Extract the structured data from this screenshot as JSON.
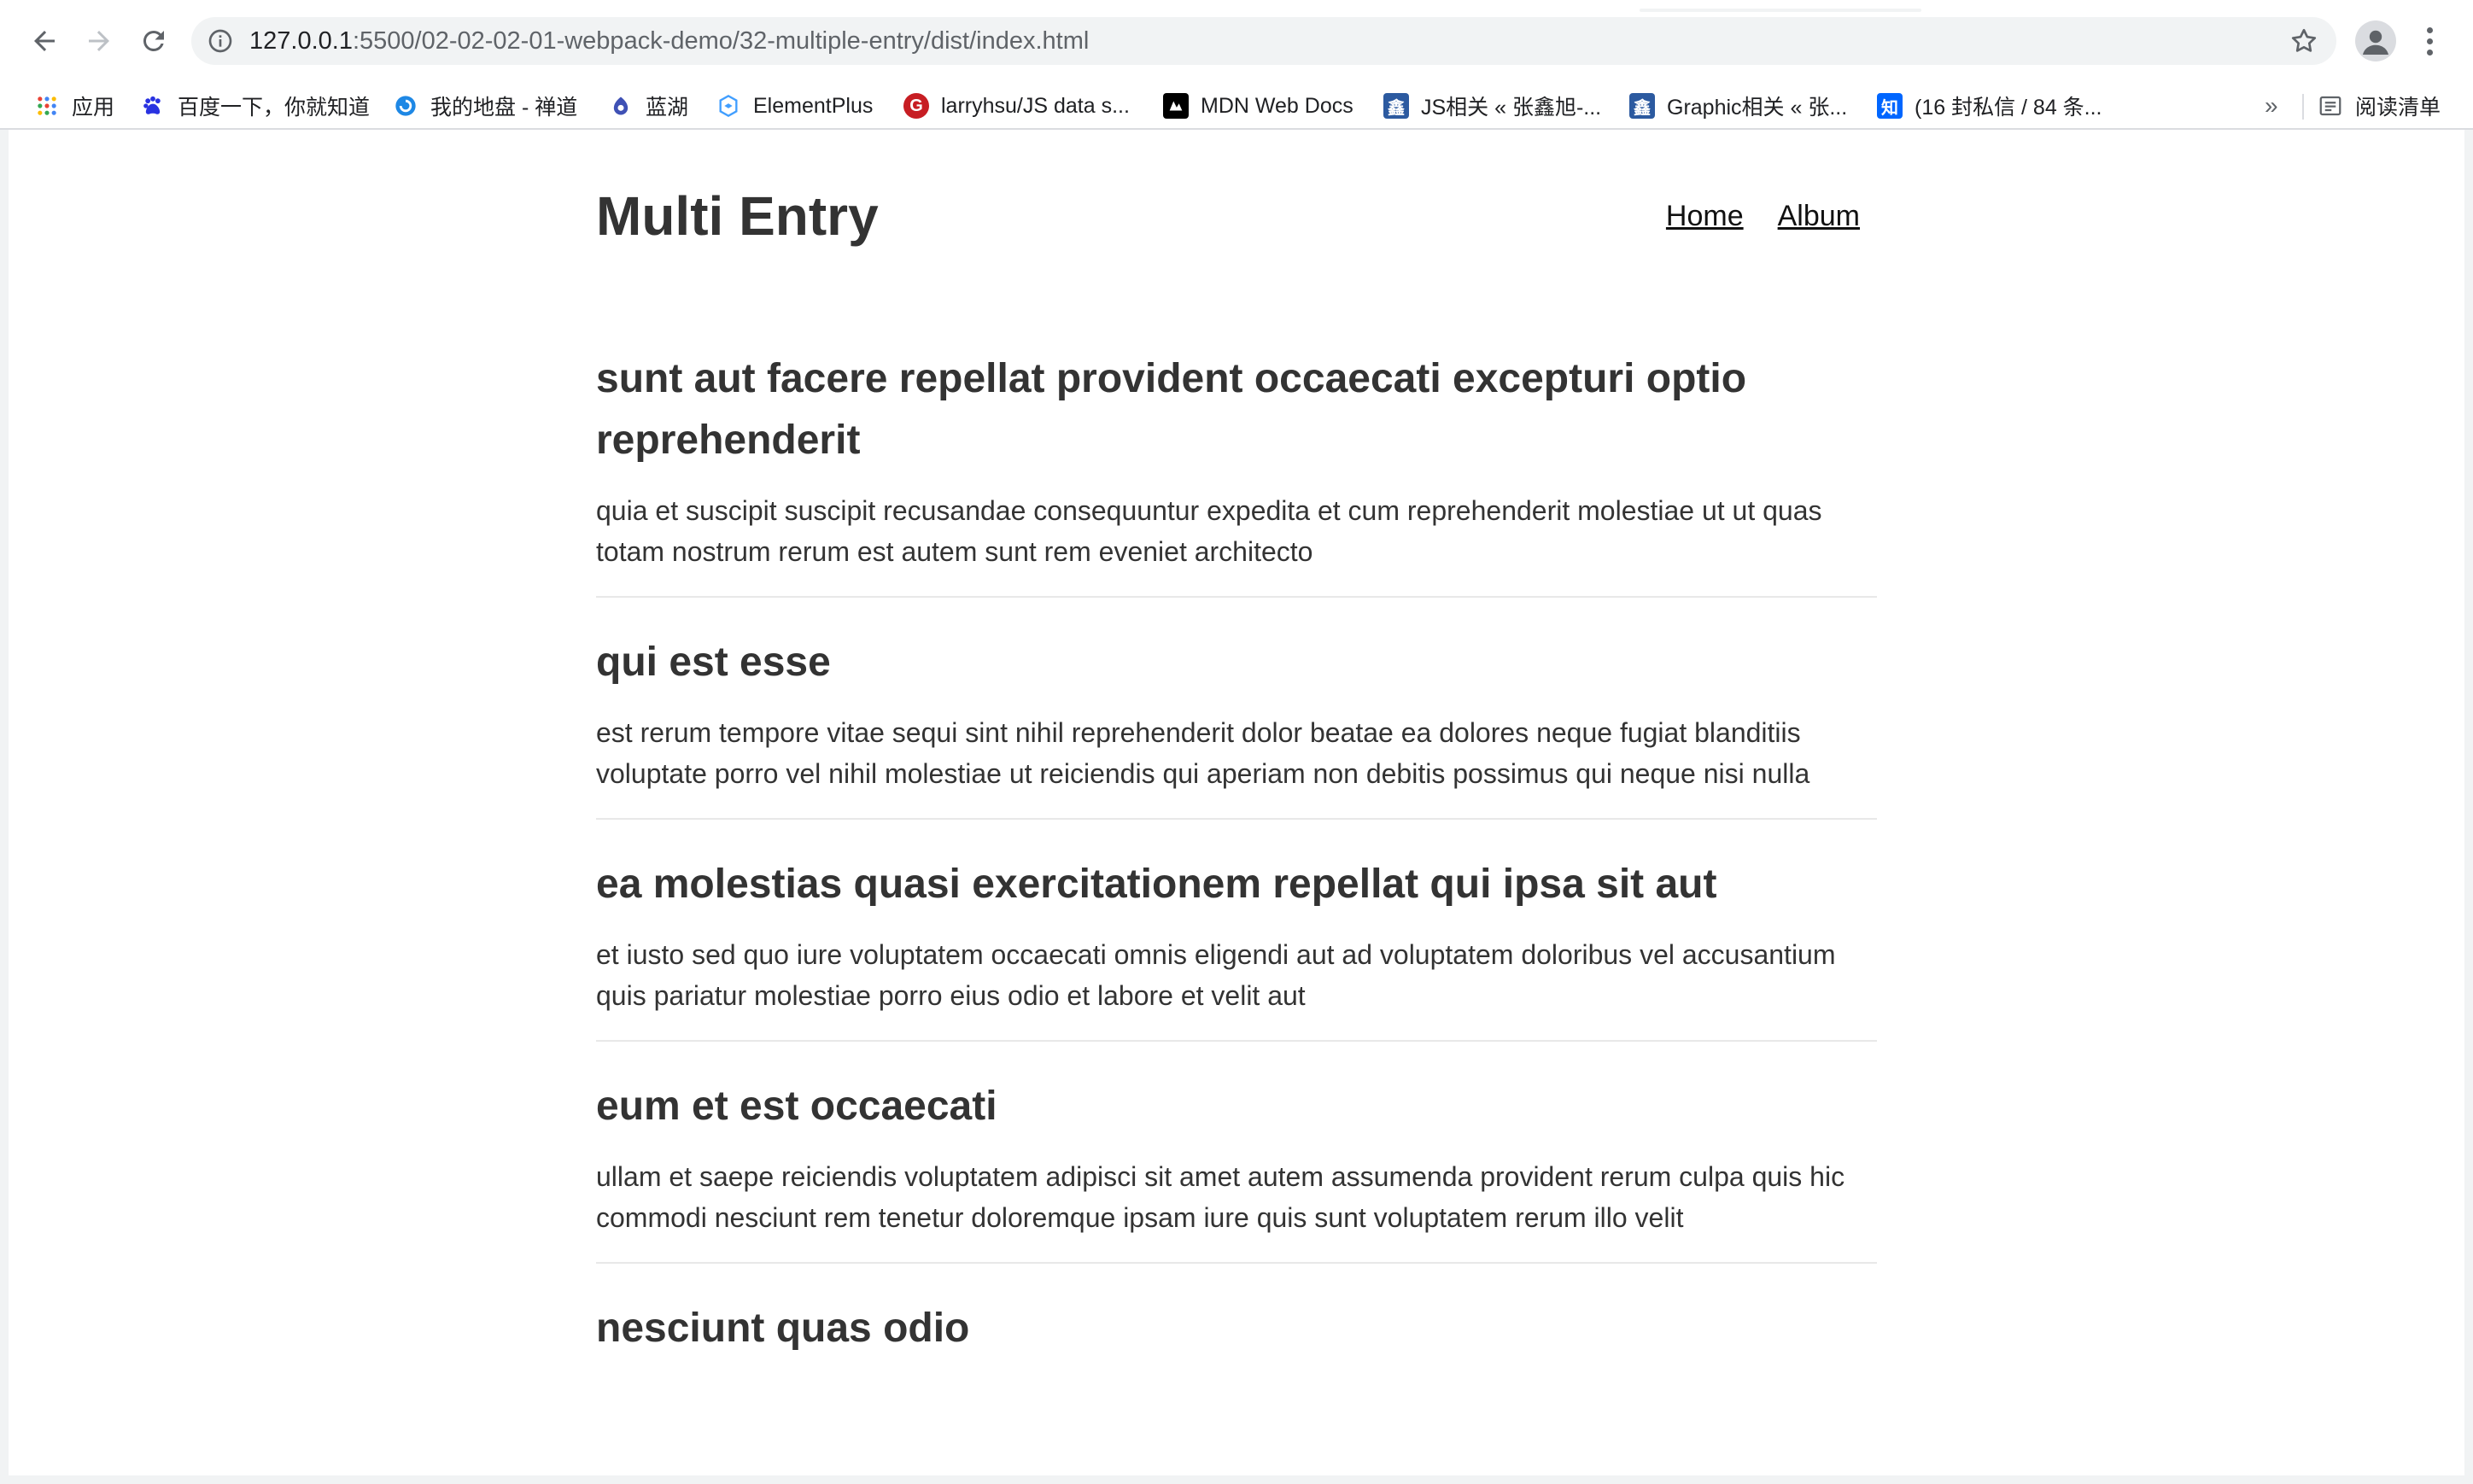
{
  "browser": {
    "url_host": "127.0.0.1",
    "url_path": ":5500/02-02-02-01-webpack-demo/32-multiple-entry/dist/index.html",
    "bookmarks": [
      {
        "label": "应用",
        "icon": "apps-grid-icon"
      },
      {
        "label": "百度一下，你就知道",
        "icon": "baidu-icon"
      },
      {
        "label": "我的地盘 - 禅道",
        "icon": "zentao-icon"
      },
      {
        "label": "蓝湖",
        "icon": "lanhu-icon"
      },
      {
        "label": "ElementPlus",
        "icon": "elementplus-icon"
      },
      {
        "label": "larryhsu/JS data s...",
        "icon": "gitee-icon"
      },
      {
        "label": "MDN Web Docs",
        "icon": "mdn-icon"
      },
      {
        "label": "JS相关 « 张鑫旭-...",
        "icon": "zxx-icon"
      },
      {
        "label": "Graphic相关 « 张...",
        "icon": "zxx-icon"
      },
      {
        "label": "(16 封私信 / 84 条...",
        "icon": "zhihu-icon"
      }
    ],
    "more_label": "»",
    "reading_list_label": "阅读清单"
  },
  "site": {
    "title": "Multi Entry",
    "nav": [
      "Home",
      "Album"
    ]
  },
  "posts": [
    {
      "title": "sunt aut facere repellat provident occaecati excepturi optio reprehenderit",
      "body": "quia et suscipit suscipit recusandae consequuntur expedita et cum reprehenderit molestiae ut ut quas totam nostrum rerum est autem sunt rem eveniet architecto"
    },
    {
      "title": "qui est esse",
      "body": "est rerum tempore vitae sequi sint nihil reprehenderit dolor beatae ea dolores neque fugiat blanditiis voluptate porro vel nihil molestiae ut reiciendis qui aperiam non debitis possimus qui neque nisi nulla"
    },
    {
      "title": "ea molestias quasi exercitationem repellat qui ipsa sit aut",
      "body": "et iusto sed quo iure voluptatem occaecati omnis eligendi aut ad voluptatem doloribus vel accusantium quis pariatur molestiae porro eius odio et labore et velit aut"
    },
    {
      "title": "eum et est occaecati",
      "body": "ullam et saepe reiciendis voluptatem adipisci sit amet autem assumenda provident rerum culpa quis hic commodi nesciunt rem tenetur doloremque ipsam iure quis sunt voluptatem rerum illo velit"
    },
    {
      "title": "nesciunt quas odio",
      "body": ""
    }
  ]
}
